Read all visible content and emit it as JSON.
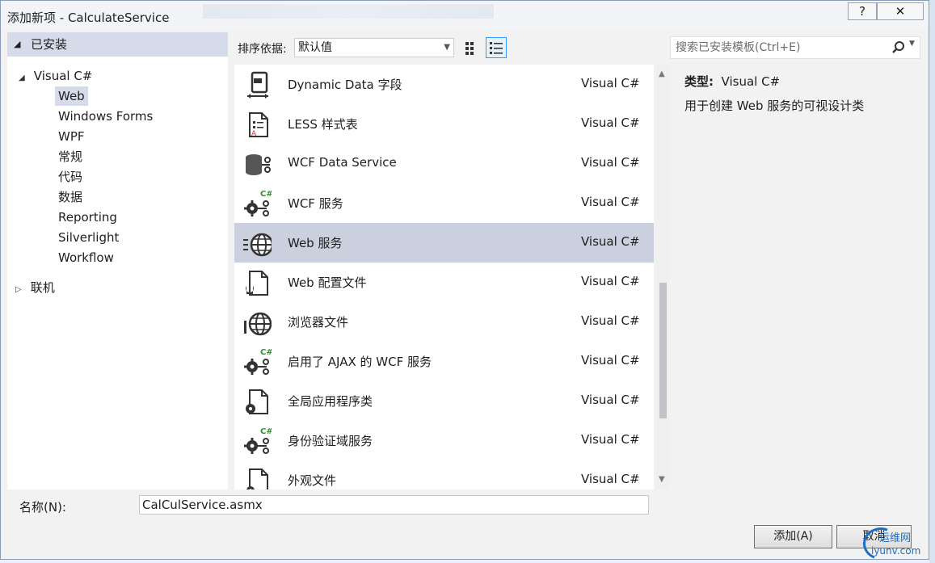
{
  "window": {
    "title": "添加新项 - CalculateService",
    "help_label": "?",
    "close_label": "✕"
  },
  "tree": {
    "installed_label": "已安装",
    "visual_csharp_label": "Visual C#",
    "items": [
      "Web",
      "Windows Forms",
      "WPF",
      "常规",
      "代码",
      "数据",
      "Reporting",
      "Silverlight",
      "Workflow"
    ],
    "selected_index": 0,
    "online_label": "联机"
  },
  "toolbar": {
    "sort_label": "排序依据:",
    "sort_value": "默认值"
  },
  "search": {
    "placeholder": "搜索已安装模板(Ctrl+E)"
  },
  "templates": [
    {
      "name": "Dynamic Data 字段",
      "lang": "Visual C#",
      "icon": "dynamic-data-icon"
    },
    {
      "name": "LESS 样式表",
      "lang": "Visual C#",
      "icon": "stylesheet-icon"
    },
    {
      "name": "WCF Data Service",
      "lang": "Visual C#",
      "icon": "data-service-icon"
    },
    {
      "name": "WCF 服务",
      "lang": "Visual C#",
      "icon": "wcf-service-icon"
    },
    {
      "name": "Web 服务",
      "lang": "Visual C#",
      "icon": "web-service-icon"
    },
    {
      "name": "Web 配置文件",
      "lang": "Visual C#",
      "icon": "config-file-icon"
    },
    {
      "name": "浏览器文件",
      "lang": "Visual C#",
      "icon": "browser-file-icon"
    },
    {
      "name": "启用了 AJAX 的 WCF 服务",
      "lang": "Visual C#",
      "icon": "ajax-wcf-service-icon"
    },
    {
      "name": "全局应用程序类",
      "lang": "Visual C#",
      "icon": "global-app-class-icon"
    },
    {
      "name": "身份验证域服务",
      "lang": "Visual C#",
      "icon": "auth-domain-service-icon"
    },
    {
      "name": "外观文件",
      "lang": "Visual C#",
      "icon": "skin-file-icon"
    }
  ],
  "selected_template_index": 4,
  "details": {
    "type_label": "类型:",
    "type_value": "Visual C#",
    "description": "用于创建 Web 服务的可视设计类"
  },
  "footer": {
    "name_label": "名称(N):",
    "name_value": "CalCulService.asmx",
    "add_label": "添加(A)",
    "cancel_label": "取消"
  },
  "watermark": {
    "text_cn": "运维网",
    "text_url": "iyunv.com"
  }
}
